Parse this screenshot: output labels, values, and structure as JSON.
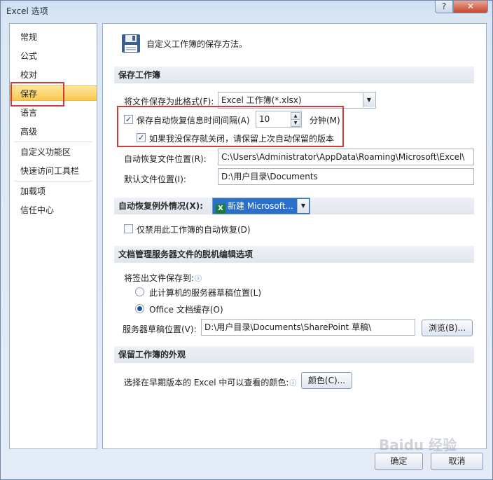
{
  "window": {
    "title": "Excel 选项",
    "help": "?",
    "close": "✕"
  },
  "sidebar": {
    "items": [
      "常规",
      "公式",
      "校对",
      "保存",
      "语言",
      "高级",
      "自定义功能区",
      "快速访问工具栏",
      "加载项",
      "信任中心"
    ],
    "selected": "保存"
  },
  "header": {
    "text": "自定义工作簿的保存方法。",
    "icon": "save-disk-icon"
  },
  "save_workbooks": {
    "title": "保存工作簿",
    "format_label": "将文件保存为此格式(F):",
    "format_value": "Excel 工作簿(*.xlsx)",
    "autorecover_label": "保存自动恢复信息时间间隔(A)",
    "autorecover_checked": true,
    "interval_value": "10",
    "minutes_label": "分钟(M)",
    "keep_last_label": "如果我没保存就关闭，请保留上次自动保留的版本",
    "keep_last_checked": true,
    "ar_location_label": "自动恢复文件位置(R):",
    "ar_location_value": "C:\\Users\\Administrator\\AppData\\Roaming\\Microsoft\\Excel\\",
    "default_location_label": "默认文件位置(I):",
    "default_location_value": "D:\\用户目录\\Documents"
  },
  "ar_exceptions": {
    "title": "自动恢复例外情况(X):",
    "workbook_value": "新建 Microsoft...",
    "disable_label": "仅禁用此工作簿的自动恢复(D)",
    "disable_checked": false
  },
  "offline": {
    "title": "文档管理服务器文件的脱机编辑选项",
    "save_to_label": "将签出文件保存到:",
    "radio1_label": "此计算机的服务器草稿位置(L)",
    "radio2_label": "Office 文档缓存(O)",
    "selected": "radio2",
    "drafts_label": "服务器草稿位置(V):",
    "drafts_value": "D:\\用户目录\\Documents\\SharePoint 草稿\\",
    "browse_label": "浏览(B)..."
  },
  "appearance": {
    "title": "保留工作簿的外观",
    "colors_label": "选择在早期版本的 Excel 中可以查看的颜色:",
    "colors_button": "颜色(C)..."
  },
  "footer": {
    "ok": "确定",
    "cancel": "取消"
  },
  "watermark": "Baidu 经验",
  "colors": {
    "highlight": "#d43a3a",
    "selected_nav": "#f7c850",
    "accent_blue": "#2f6cc7"
  }
}
